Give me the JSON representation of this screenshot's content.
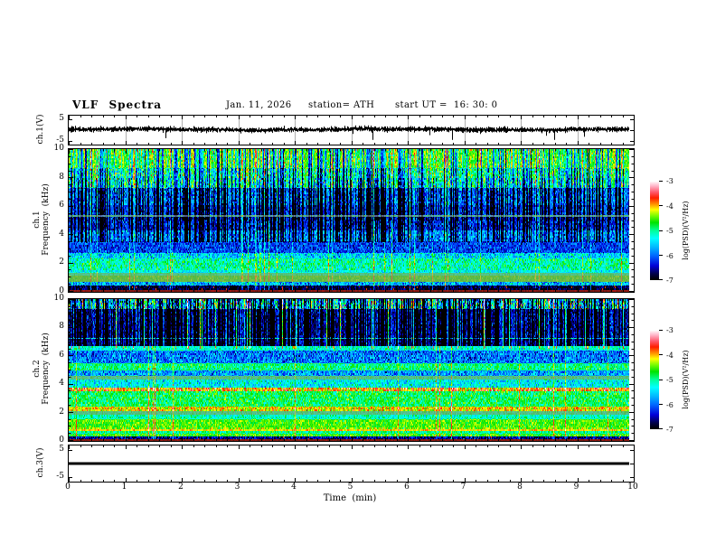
{
  "header": {
    "title": "VLF Spectra",
    "date": "Jan. 11, 2026",
    "station": "station= ATH",
    "start_ut": "start UT =  16: 30: 0"
  },
  "axes": {
    "time_label": "Time  (min)",
    "time_ticks": [
      "0",
      "1",
      "2",
      "3",
      "4",
      "5",
      "6",
      "7",
      "8",
      "9",
      "10"
    ],
    "freq_ticks": [
      "10",
      "8",
      "6",
      "4",
      "2",
      "0"
    ],
    "volt_ticks": [
      "5",
      "-5"
    ],
    "psd_ticks": [
      "-3",
      "-4",
      "-5",
      "-6",
      "-7"
    ],
    "wave_label": "ch.1(V)",
    "spec1_label": "ch.1\nFrequency  (kHz)",
    "spec2_label": "ch.2\nFrequency  (kHz)",
    "ch3_label": "ch.3(V)",
    "colorbar_label": "log(PSD)(V²/Hz)"
  },
  "palette": {
    "range": [
      -7,
      -3
    ],
    "stops": [
      [
        0.0,
        "#000000"
      ],
      [
        0.06,
        "#00004a"
      ],
      [
        0.14,
        "#0000d8"
      ],
      [
        0.24,
        "#0064ff"
      ],
      [
        0.33,
        "#00b8ff"
      ],
      [
        0.42,
        "#00ffff"
      ],
      [
        0.5,
        "#00ff96"
      ],
      [
        0.58,
        "#00e400"
      ],
      [
        0.65,
        "#7cfc00"
      ],
      [
        0.71,
        "#ffff00"
      ],
      [
        0.77,
        "#ff8c00"
      ],
      [
        0.83,
        "#ff1e00"
      ],
      [
        0.89,
        "#ff5a6e"
      ],
      [
        0.95,
        "#ffb4c8"
      ],
      [
        1.0,
        "#ffffff"
      ]
    ]
  },
  "chart_data": [
    {
      "type": "line",
      "name": "ch1-voltage-waveform",
      "panel": "wave",
      "ylabel": "ch.1(V)",
      "yticks": [
        5,
        -5
      ],
      "ylim": [
        -6.7,
        6.7
      ],
      "xlim_min": [
        0,
        10
      ],
      "data_end_min": 9.92,
      "line_color": "#000000",
      "grid_minute_lines": true,
      "signal": {
        "baseline_v": 0.3,
        "noise_sigma_v": 0.5,
        "downward_spike_rate": 0.012,
        "downward_spike_max_v": -4.5,
        "upward_spike_rate": 0.005,
        "upward_spike_max_v": 2.2
      },
      "seed": 20260111
    },
    {
      "type": "heatmap",
      "name": "ch1-spectrogram",
      "panel": "spec1",
      "ylabel": "ch.1 Frequency (kHz)",
      "ylim": [
        0,
        10
      ],
      "yticks": [
        10,
        8,
        6,
        4,
        2,
        0
      ],
      "xlim_min": [
        0,
        10
      ],
      "data_end_min": 9.92,
      "colorbar": {
        "label": "log(PSD)(V²/Hz)",
        "ticks": [
          -3,
          -4,
          -5,
          -6,
          -7
        ],
        "range": [
          -7,
          -3
        ]
      },
      "bands": [
        {
          "lo": 8.7,
          "hi": 10.01,
          "lv": -4.5,
          "v": 0.35,
          "cv": 0.25
        },
        {
          "lo": 7.3,
          "hi": 8.7,
          "lv": -4.95,
          "v": 0.5,
          "cv": 0.3
        },
        {
          "lo": 6.1,
          "hi": 7.3,
          "lv": -5.9,
          "v": 0.45
        },
        {
          "lo": 5.4,
          "hi": 6.1,
          "lv": -6.15,
          "v": 0.35
        },
        {
          "lo": 5.25,
          "hi": 5.4,
          "lv": -5.0,
          "v": 0.2,
          "gray": 1
        },
        {
          "lo": 4.3,
          "hi": 5.25,
          "lv": -6.3,
          "v": 0.4
        },
        {
          "lo": 3.55,
          "hi": 4.3,
          "lv": -5.85,
          "v": 0.45
        },
        {
          "lo": 2.7,
          "hi": 3.55,
          "lv": -6.2,
          "v": 0.35
        },
        {
          "lo": 2.35,
          "hi": 2.7,
          "lv": -5.5,
          "v": 0.45
        },
        {
          "lo": 1.5,
          "hi": 2.35,
          "lv": -5.1,
          "v": 0.4
        },
        {
          "lo": 1.32,
          "hi": 1.5,
          "lv": -5.35,
          "v": 0.3
        },
        {
          "lo": 1.14,
          "hi": 1.32,
          "lv": -5.0,
          "v": 0.15,
          "gray": 1
        },
        {
          "lo": 0.68,
          "hi": 1.14,
          "lv": -4.6,
          "v": 0.15,
          "gray": 1
        },
        {
          "lo": 0.42,
          "hi": 0.68,
          "lv": -5.7,
          "v": 0.5
        },
        {
          "lo": 0.12,
          "hi": 0.42,
          "lv": -6.85,
          "v": 0.3,
          "spz": 1.65
        },
        {
          "lo": 0.0,
          "hi": 0.12,
          "lv": -3.8,
          "v": 0.2,
          "dr": 1
        }
      ],
      "dark_streaks": [
        {
          "density": 0.45,
          "fmin": 3.5,
          "fmax": 10,
          "dmin": 0.5,
          "dmax": 2.0
        },
        {
          "density": 0.25,
          "fmin": 5.0,
          "fmax": 8.0,
          "dmin": 0.4,
          "dmax": 1.4
        }
      ],
      "bright_streaks": [
        {
          "density": 0.05,
          "fmin": 0,
          "fmax": 10,
          "bmin": 0.5,
          "bmax": 1.1
        }
      ],
      "seed": 1611
    },
    {
      "type": "heatmap",
      "name": "ch2-spectrogram",
      "panel": "spec2",
      "ylabel": "ch.2 Frequency (kHz)",
      "ylim": [
        0,
        10
      ],
      "yticks": [
        10,
        8,
        6,
        4,
        2,
        0
      ],
      "xlim_min": [
        0,
        10
      ],
      "data_end_min": 9.92,
      "colorbar": {
        "label": "log(PSD)(V²/Hz)",
        "ticks": [
          -3,
          -4,
          -5,
          -6,
          -7
        ],
        "range": [
          -7,
          -3
        ]
      },
      "bands": [
        {
          "lo": 9.35,
          "hi": 10.01,
          "lv": -5.4,
          "v": 0.7,
          "cv": 0.7
        },
        {
          "lo": 7.18,
          "hi": 7.3,
          "lv": -5.2,
          "v": 0.25
        },
        {
          "lo": 6.72,
          "hi": 9.35,
          "lv": -6.5,
          "v": 0.35,
          "cv": 0.3
        },
        {
          "lo": 6.35,
          "hi": 6.72,
          "lv": -5.2,
          "v": 0.35
        },
        {
          "lo": 5.5,
          "hi": 6.35,
          "lv": -5.95,
          "v": 0.45
        },
        {
          "lo": 5.0,
          "hi": 5.5,
          "lv": -4.95,
          "v": 0.35
        },
        {
          "lo": 4.6,
          "hi": 5.0,
          "lv": -5.8,
          "v": 0.45
        },
        {
          "lo": 4.35,
          "hi": 4.6,
          "lv": -5.0,
          "v": 0.25,
          "gray": 1
        },
        {
          "lo": 3.72,
          "hi": 4.35,
          "lv": -5.35,
          "v": 0.4
        },
        {
          "lo": 3.5,
          "hi": 3.72,
          "lv": -3.95,
          "v": 0.5
        },
        {
          "lo": 2.4,
          "hi": 3.5,
          "lv": -4.85,
          "v": 0.35
        },
        {
          "lo": 2.1,
          "hi": 2.4,
          "lv": -4.15,
          "v": 0.35
        },
        {
          "lo": 1.85,
          "hi": 2.1,
          "lv": -5.0,
          "v": 0.2,
          "gray": 1
        },
        {
          "lo": 1.5,
          "hi": 1.85,
          "lv": -5.15,
          "v": 0.3
        },
        {
          "lo": 0.95,
          "hi": 1.5,
          "lv": -4.55,
          "v": 0.25
        },
        {
          "lo": 0.78,
          "hi": 0.95,
          "lv": -4.45,
          "v": 0.35
        },
        {
          "lo": 0.65,
          "hi": 0.78,
          "lv": -4.1,
          "v": 0.2
        },
        {
          "lo": 0.45,
          "hi": 0.65,
          "lv": -5.0,
          "v": 0.3
        },
        {
          "lo": 0.28,
          "hi": 0.45,
          "lv": -4.6,
          "v": 0.3
        },
        {
          "lo": 0.1,
          "hi": 0.28,
          "lv": -6.6,
          "v": 0.4,
          "spz": 1.9
        },
        {
          "lo": 0.0,
          "hi": 0.1,
          "lv": -3.9,
          "v": 0.2,
          "dr": 1
        }
      ],
      "dark_streaks": [
        {
          "density": 0.5,
          "fmin": 6.72,
          "fmax": 10,
          "dmin": 0.8,
          "dmax": 2.4
        }
      ],
      "bright_streaks": [
        {
          "density": 0.09,
          "fmin": 6.5,
          "fmax": 10,
          "bmin": 0.9,
          "bmax": 1.9
        },
        {
          "density": 0.018,
          "fmin": 0,
          "fmax": 10,
          "bmin": 0.6,
          "bmax": 1.0
        }
      ],
      "seed": 1612
    },
    {
      "type": "line",
      "name": "ch3-voltage-flatline",
      "panel": "ch3",
      "ylabel": "ch.3(V)",
      "yticks": [
        5,
        -5
      ],
      "ylim": [
        -6.7,
        6.7
      ],
      "xlim_min": [
        0,
        10
      ],
      "data_end_min": 9.92,
      "line_color": "#000000",
      "signal": {
        "constant_v": 0,
        "thickness_px": 3
      },
      "seed": 3
    }
  ]
}
